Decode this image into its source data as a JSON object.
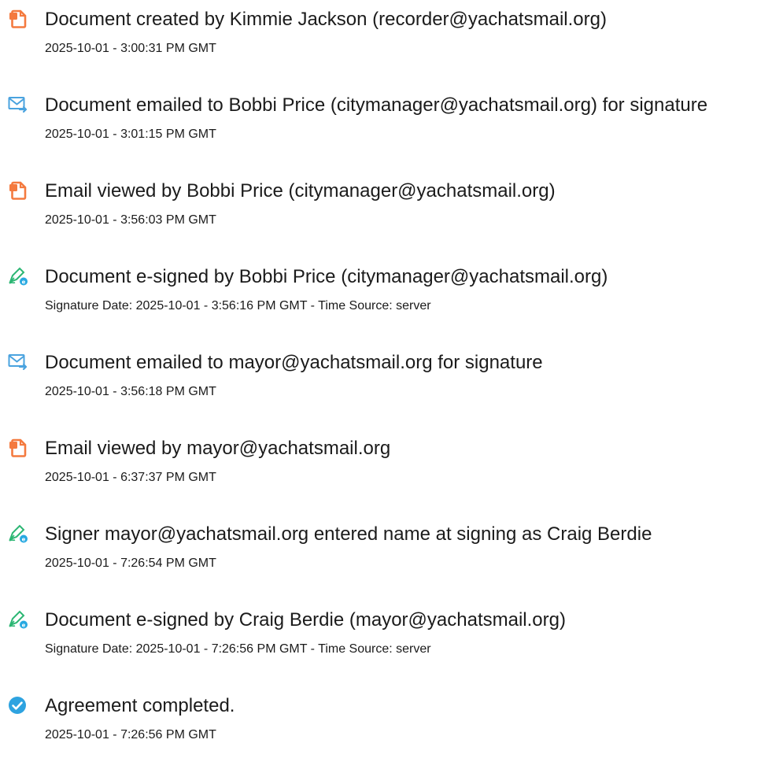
{
  "events": [
    {
      "icon": "document-icon",
      "title": "Document created by Kimmie Jackson (recorder@yachatsmail.org)",
      "detail": "2025-10-01 - 3:00:31 PM GMT"
    },
    {
      "icon": "email-icon",
      "title": "Document emailed to Bobbi Price (citymanager@yachatsmail.org) for signature",
      "detail": "2025-10-01 - 3:01:15 PM GMT"
    },
    {
      "icon": "document-icon",
      "title": "Email viewed by Bobbi Price (citymanager@yachatsmail.org)",
      "detail": "2025-10-01 - 3:56:03 PM GMT"
    },
    {
      "icon": "pen-sign-icon",
      "title": "Document e-signed by Bobbi Price (citymanager@yachatsmail.org)",
      "detail": "Signature Date: 2025-10-01 - 3:56:16 PM GMT - Time Source: server"
    },
    {
      "icon": "email-icon",
      "title": "Document emailed to mayor@yachatsmail.org for signature",
      "detail": "2025-10-01 - 3:56:18 PM GMT"
    },
    {
      "icon": "document-icon",
      "title": "Email viewed by mayor@yachatsmail.org",
      "detail": "2025-10-01 - 6:37:37 PM GMT"
    },
    {
      "icon": "pen-sign-icon",
      "title": "Signer mayor@yachatsmail.org entered name at signing as Craig Berdie",
      "detail": "2025-10-01 - 7:26:54 PM GMT"
    },
    {
      "icon": "pen-sign-icon",
      "title": "Document e-signed by Craig Berdie (mayor@yachatsmail.org)",
      "detail": "Signature Date: 2025-10-01 - 7:26:56 PM GMT - Time Source: server"
    },
    {
      "icon": "checkmark-circle-icon",
      "title": "Agreement completed.",
      "detail": "2025-10-01 - 7:26:56 PM GMT"
    }
  ],
  "colors": {
    "document_icon": "#f47a3f",
    "email_icon": "#4aa3df",
    "pen_icon": "#2bb673",
    "pen_badge": "#27a9e1",
    "check_icon": "#2ea3e0",
    "text": "#1b1b1b"
  }
}
